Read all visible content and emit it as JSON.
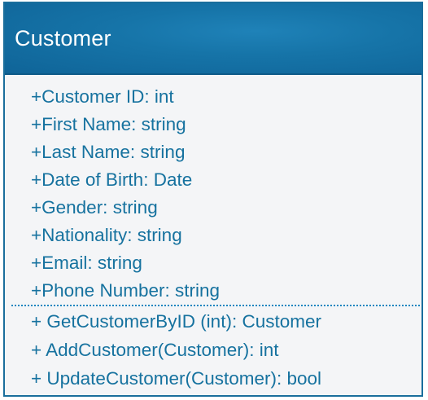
{
  "class": {
    "name": "Customer",
    "attributes": [
      "+Customer ID: int",
      "+First Name: string",
      "+Last Name: string",
      "+Date of Birth: Date",
      "+Gender: string",
      "+Nationality: string",
      "+Email: string",
      "+Phone Number: string"
    ],
    "operations": [
      "+ GetCustomerByID (int): Customer",
      "+ AddCustomer(Customer): int",
      "+ UpdateCustomer(Customer): bool"
    ]
  },
  "colors": {
    "header_background": "#1674a8",
    "border": "#1a6e9c",
    "text": "#16729f",
    "body_background": "#f4f5f7"
  }
}
